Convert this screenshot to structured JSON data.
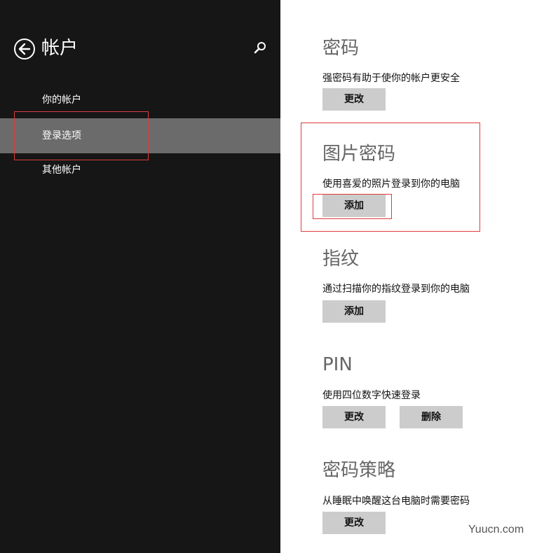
{
  "sidebar": {
    "title": "帐户",
    "items": [
      {
        "label": "你的帐户"
      },
      {
        "label": "登录选项"
      },
      {
        "label": "其他帐户"
      }
    ]
  },
  "sections": {
    "password": {
      "title": "密码",
      "desc": "强密码有助于使你的帐户更安全",
      "button": "更改"
    },
    "picture": {
      "title": "图片密码",
      "desc": "使用喜爱的照片登录到你的电脑",
      "button": "添加"
    },
    "fingerprint": {
      "title": "指纹",
      "desc": "通过扫描你的指纹登录到你的电脑",
      "button": "添加"
    },
    "pin": {
      "title": "PIN",
      "desc": "使用四位数字快速登录",
      "button": "更改",
      "button2": "删除"
    },
    "policy": {
      "title": "密码策略",
      "desc": "从睡眠中唤醒这台电脑时需要密码",
      "button": "更改"
    }
  },
  "watermark": "Yuucn.com",
  "colors": {
    "sidebar_bg": "#161616",
    "selected_bg": "#6b6b6b",
    "button_bg": "#cccccc",
    "highlight_box": "#e03b3b"
  }
}
